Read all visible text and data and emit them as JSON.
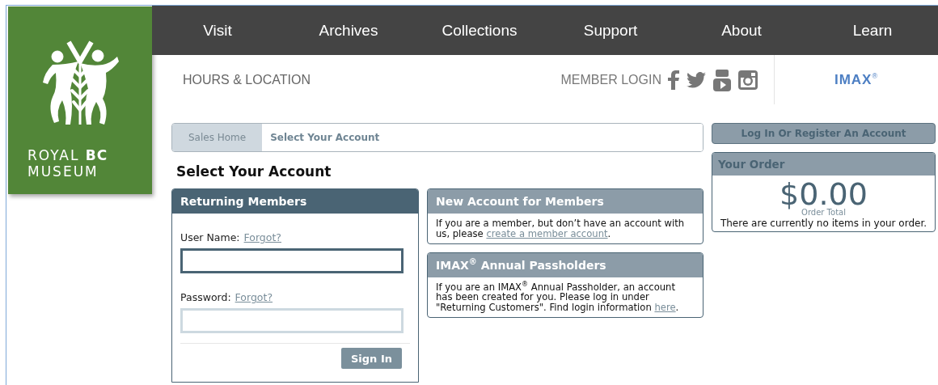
{
  "logo": {
    "line_1": "ROYAL **BC**",
    "line_2": "MUSEUM"
  },
  "nav": {
    "items": [
      "Visit",
      "Archives",
      "Collections",
      "Support",
      "About",
      "Learn"
    ]
  },
  "subnav": {
    "hours_link": "HOURS & LOCATION",
    "member_login": "MEMBER LOGIN",
    "imax": "IMAX$^{®}$"
  },
  "breadcrumb": [
    {
      "label": "Sales Home",
      "selected": false
    },
    {
      "label": "Select Your Account",
      "selected": true
    }
  ],
  "page_title": "Select Your Account",
  "login_panel": {
    "title": "Returning Members",
    "fields": [
      {
        "label": "User Name:",
        "link": "Forgot?",
        "focused": true
      },
      {
        "label": "Password:",
        "link": "Forgot?",
        "focused": false
      }
    ],
    "button": "Sign In"
  },
  "info_panels": [
    {
      "title": "New Account for Members",
      "text_before": "If you are a member, but don’t have an account with us, please ",
      "link": "create a member account",
      "text_after": "."
    },
    {
      "title": "IMAX$^{®}$ Annual Passholders",
      "text_before": "If you are an IMAX$^{®}$ Annual Passholder, an account has been created for you. Please log in under \"Returning Customers\". Find login information ",
      "link": "here",
      "text_after": "."
    }
  ],
  "account_button": "Log In Or Register An Account",
  "order": {
    "title": "Your Order",
    "total": "$0.00",
    "total_label": "Order Total",
    "message": "There are currently no items in your order."
  }
}
